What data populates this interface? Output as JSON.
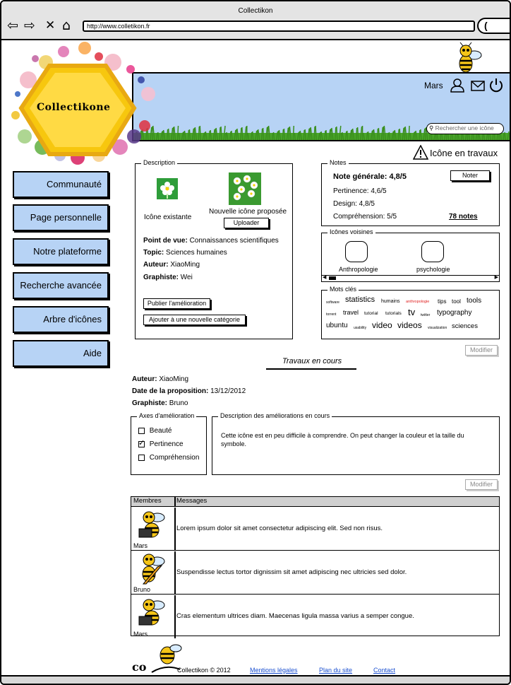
{
  "browser": {
    "title": "Collectikon",
    "url": "http://www.colletikon.fr",
    "go_label": "(",
    "nav": {
      "back": "back-arrow-icon",
      "forward": "forward-arrow-icon",
      "stop": "close-icon",
      "home": "home-icon"
    }
  },
  "header": {
    "logo": "Collectikone",
    "user": "Mars",
    "search_placeholder": "Rechercher une icône",
    "icons": [
      "user-icon",
      "mail-icon",
      "power-icon"
    ],
    "work_notice": "Icône en travaux"
  },
  "nav": {
    "items": [
      {
        "label": "Communauté"
      },
      {
        "label": "Page personnelle"
      },
      {
        "label": "Notre plateforme"
      },
      {
        "label": "Recherche avancée"
      },
      {
        "label": "Arbre d'icônes"
      },
      {
        "label": "Aide"
      }
    ]
  },
  "description": {
    "legend": "Description",
    "existing_label": "Icône existante",
    "proposed_label": "Nouvelle icône proposée",
    "upload_label": "Uploader",
    "point_de_vue_label": "Point de vue:",
    "point_de_vue": "Connaissances scientifiques",
    "topic_label": "Topic:",
    "topic": "Sciences humaines",
    "auteur_label": "Auteur:",
    "auteur": "XiaoMing",
    "graphiste_label": "Graphiste:",
    "graphiste": "Wei",
    "publish_label": "Publier l'amélioration",
    "add_category_label": "Ajouter à une nouvelle catégorie"
  },
  "notes": {
    "legend": "Notes",
    "general_label": "Note générale:",
    "general": "4,8/5",
    "noter_label": "Noter",
    "pertinence": "Pertinence: 4,6/5",
    "design": "Design: 4,8/5",
    "comprehension": "Compréhension: 5/5",
    "count_link": "78 notes"
  },
  "neighbors": {
    "legend": "Icônes voisines",
    "items": [
      "Anthropologie",
      "psychologie"
    ]
  },
  "keywords": {
    "legend": "Mots clés",
    "tags": [
      "software",
      "statistics",
      "humains",
      "anthropologie",
      "tips",
      "tool",
      "tools",
      "torrent",
      "travel",
      "tutorial",
      "tutorials",
      "tv",
      "twitter",
      "typography",
      "ubuntu",
      "usability",
      "video",
      "videos",
      "visualization",
      "sciences"
    ],
    "highlight": "anthropologie",
    "highlight_color": "#e02020",
    "modify_label": "Modifier"
  },
  "work": {
    "title": "Travaux en cours",
    "auteur_label": "Auteur:",
    "auteur": "XiaoMing",
    "date_label": "Date de la proposition:",
    "date": "13/12/2012",
    "graphiste_label": "Graphiste:",
    "graphiste": "Bruno",
    "axes_legend": "Axes d'amélioration",
    "axes": [
      {
        "label": "Beauté",
        "checked": false
      },
      {
        "label": "Pertinence",
        "checked": true
      },
      {
        "label": "Compréhension",
        "checked": false
      }
    ],
    "desc_legend": "Description des améliorations en cours",
    "desc_text": "Cette icône est en peu difficile à comprendre. On peut changer la couleur et la taille du symbole.",
    "modify_label": "Modifier"
  },
  "messages": {
    "col_members": "Membres",
    "col_messages": "Messages",
    "rows": [
      {
        "member": "Mars",
        "text": "Lorem ipsum dolor sit amet consectetur adipiscing elit. Sed non risus."
      },
      {
        "member": "Bruno",
        "text": "Suspendisse lectus tortor dignissim sit amet adipiscing nec ultricies sed dolor."
      },
      {
        "member": "Mars",
        "text": "Cras elementum ultrices diam. Maecenas ligula massa varius a semper congue."
      }
    ]
  },
  "footer": {
    "copyright": "Collectikon © 2012",
    "links": [
      "Mentions légales",
      "Plan du site",
      "Contact"
    ]
  }
}
